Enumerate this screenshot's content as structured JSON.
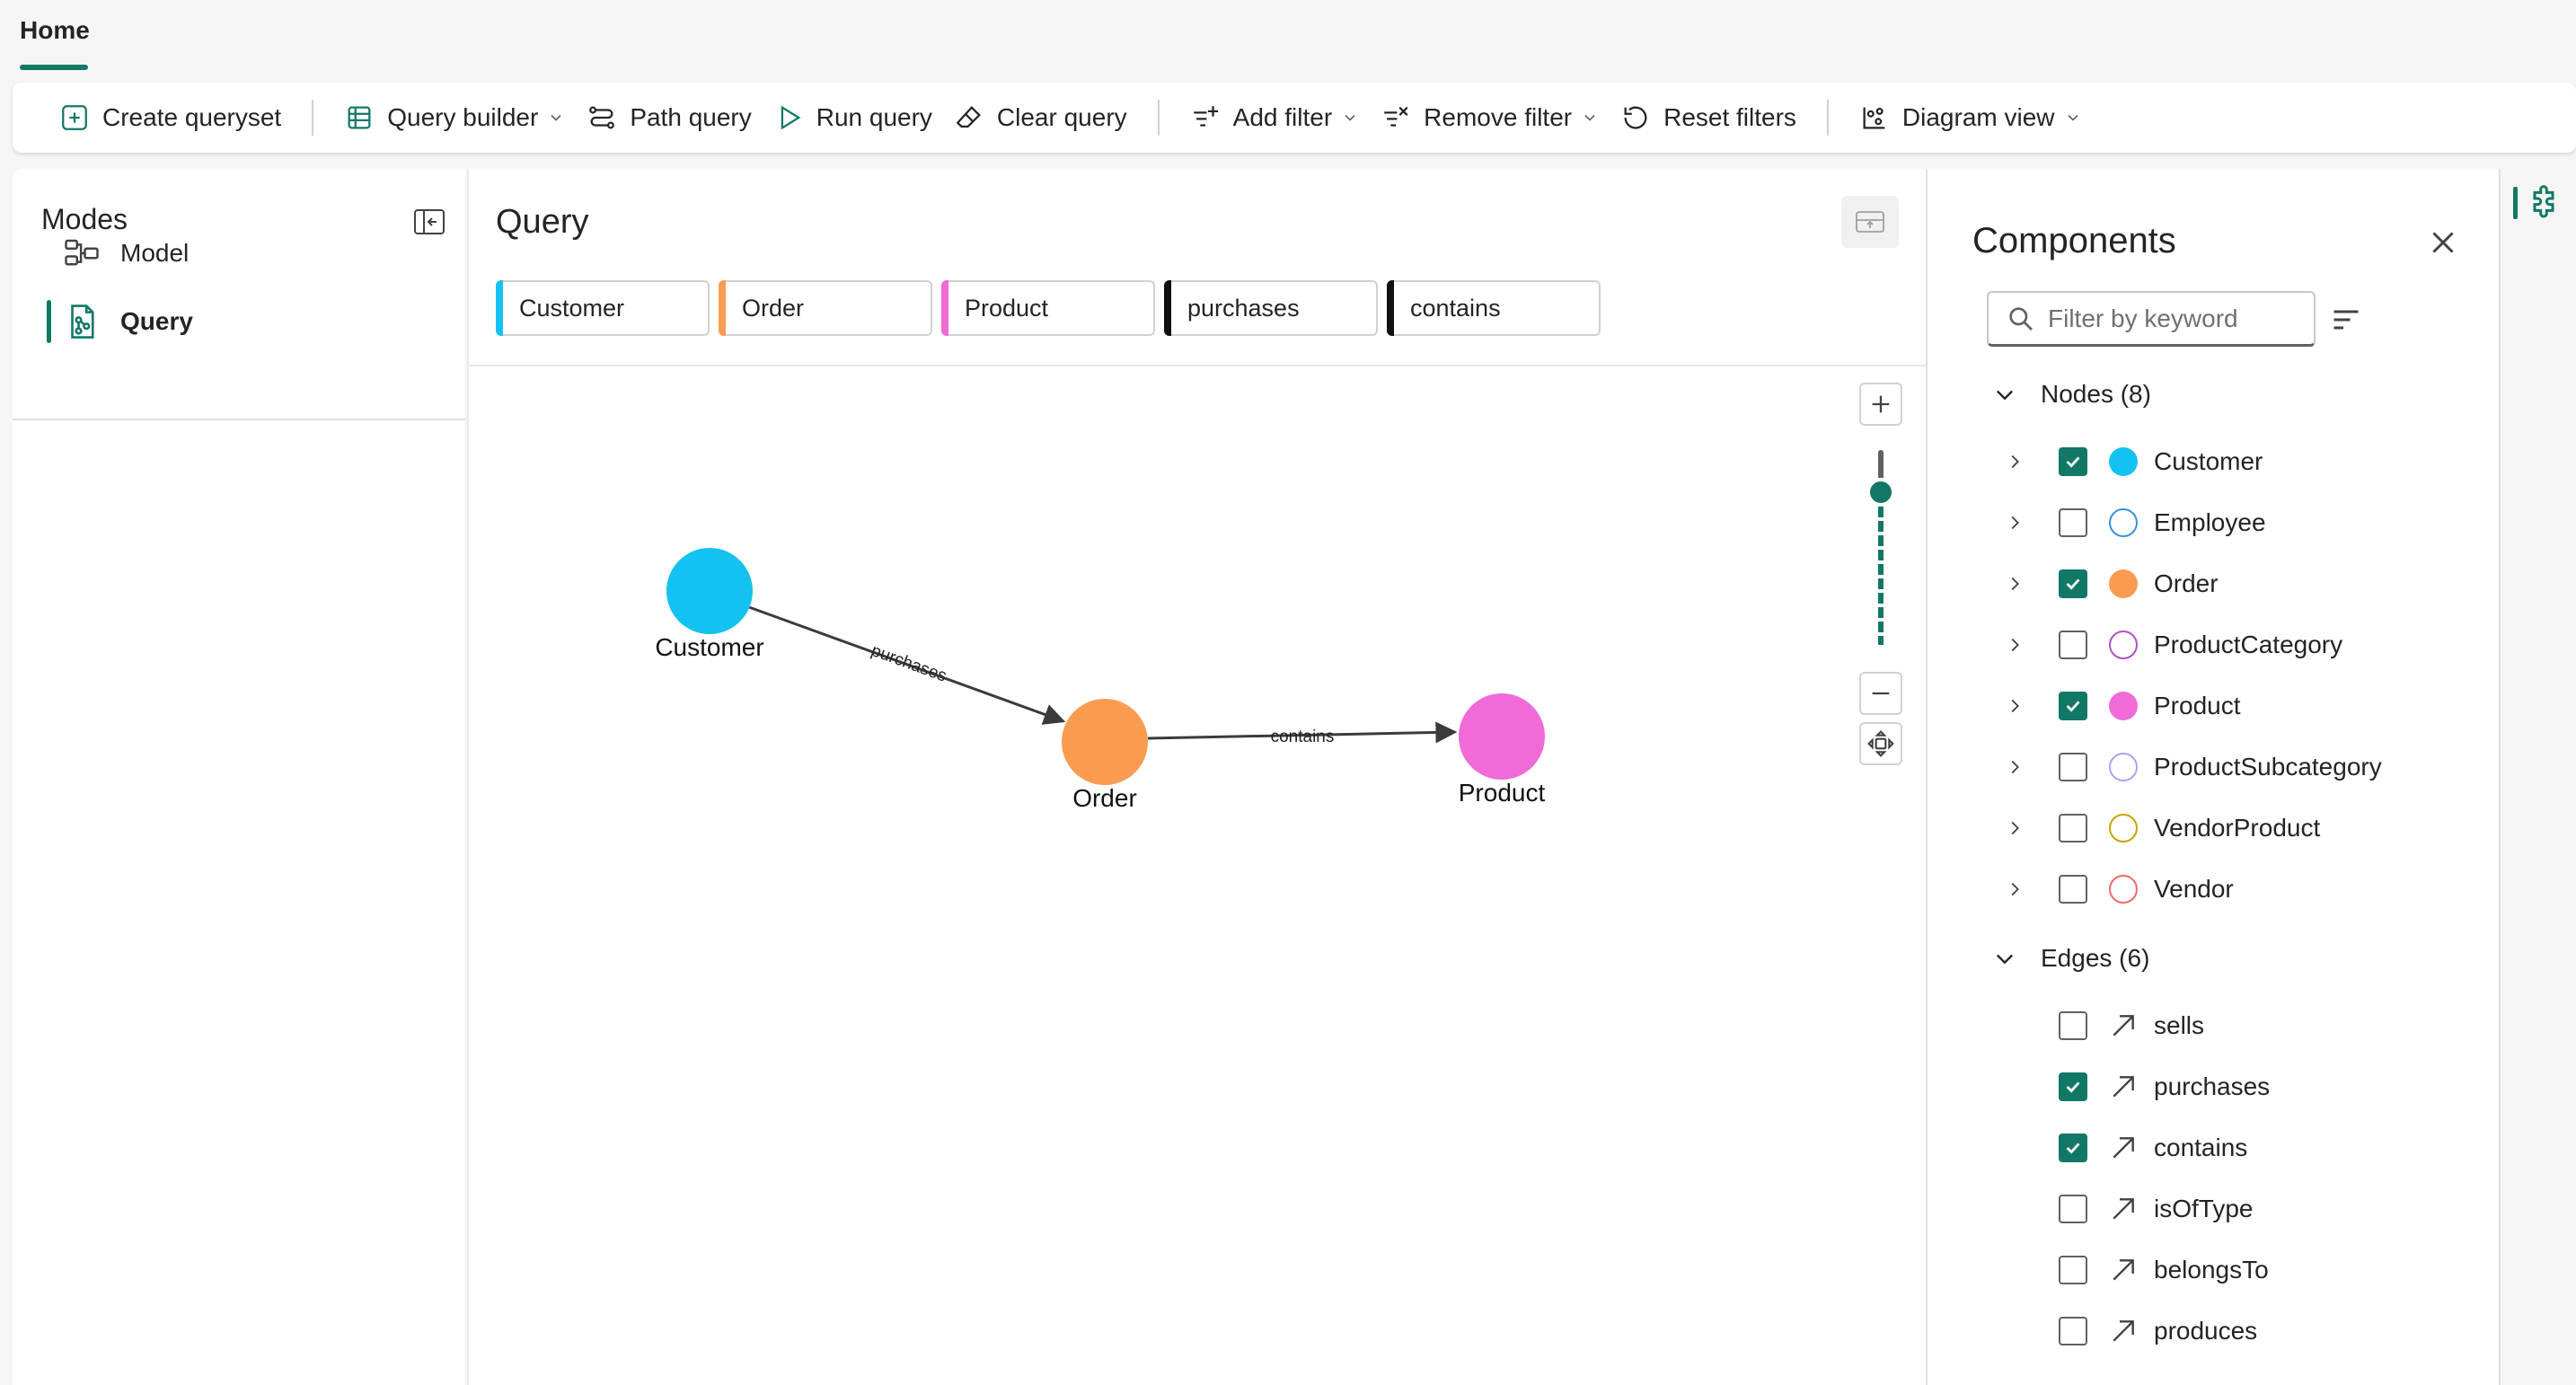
{
  "top": {
    "home_tab": "Home"
  },
  "toolbar": {
    "create_queryset": "Create queryset",
    "query_builder": "Query builder",
    "path_query": "Path query",
    "run_query": "Run query",
    "clear_query": "Clear query",
    "add_filter": "Add filter",
    "remove_filter": "Remove filter",
    "reset_filters": "Reset filters",
    "diagram_view": "Diagram view"
  },
  "modes": {
    "title": "Modes",
    "items": [
      {
        "label": "Model",
        "icon": "model-icon",
        "active": false
      },
      {
        "label": "Query",
        "icon": "query-icon",
        "active": true
      }
    ]
  },
  "query": {
    "title": "Query",
    "chips": [
      {
        "label": "Customer",
        "color": "#13c2f0"
      },
      {
        "label": "Order",
        "color": "#f99c52"
      },
      {
        "label": "Product",
        "color": "#f06ad8"
      },
      {
        "label": "purchases",
        "color": "#111111"
      },
      {
        "label": "contains",
        "color": "#111111"
      }
    ],
    "graph": {
      "nodes": [
        {
          "id": "customer",
          "label": "Customer",
          "color": "#13c2f0"
        },
        {
          "id": "order",
          "label": "Order",
          "color": "#f99c52"
        },
        {
          "id": "product",
          "label": "Product",
          "color": "#f06ad8"
        }
      ],
      "edges": [
        {
          "label": "purchases",
          "from": "customer",
          "to": "order"
        },
        {
          "label": "contains",
          "from": "order",
          "to": "product"
        }
      ],
      "zoom_level": 0.8
    }
  },
  "components": {
    "title": "Components",
    "search_placeholder": "Filter by keyword",
    "nodes_header": "Nodes (8)",
    "edges_header": "Edges (6)",
    "nodes": [
      {
        "label": "Customer",
        "checked": true,
        "color": "#13c2f0",
        "filled": true
      },
      {
        "label": "Employee",
        "checked": false,
        "color": "#3a8fd8",
        "filled": false
      },
      {
        "label": "Order",
        "checked": true,
        "color": "#f99c52",
        "filled": true
      },
      {
        "label": "ProductCategory",
        "checked": false,
        "color": "#b04fc4",
        "filled": false
      },
      {
        "label": "Product",
        "checked": true,
        "color": "#f06ad8",
        "filled": true
      },
      {
        "label": "ProductSubcategory",
        "checked": false,
        "color": "#a9a3f0",
        "filled": false
      },
      {
        "label": "VendorProduct",
        "checked": false,
        "color": "#c9a400",
        "filled": false
      },
      {
        "label": "Vendor",
        "checked": false,
        "color": "#f06a6a",
        "filled": false
      }
    ],
    "edges": [
      {
        "label": "sells",
        "checked": false
      },
      {
        "label": "purchases",
        "checked": true
      },
      {
        "label": "contains",
        "checked": true
      },
      {
        "label": "isOfType",
        "checked": false
      },
      {
        "label": "belongsTo",
        "checked": false
      },
      {
        "label": "produces",
        "checked": false
      }
    ]
  },
  "colors": {
    "accent": "#117865"
  }
}
